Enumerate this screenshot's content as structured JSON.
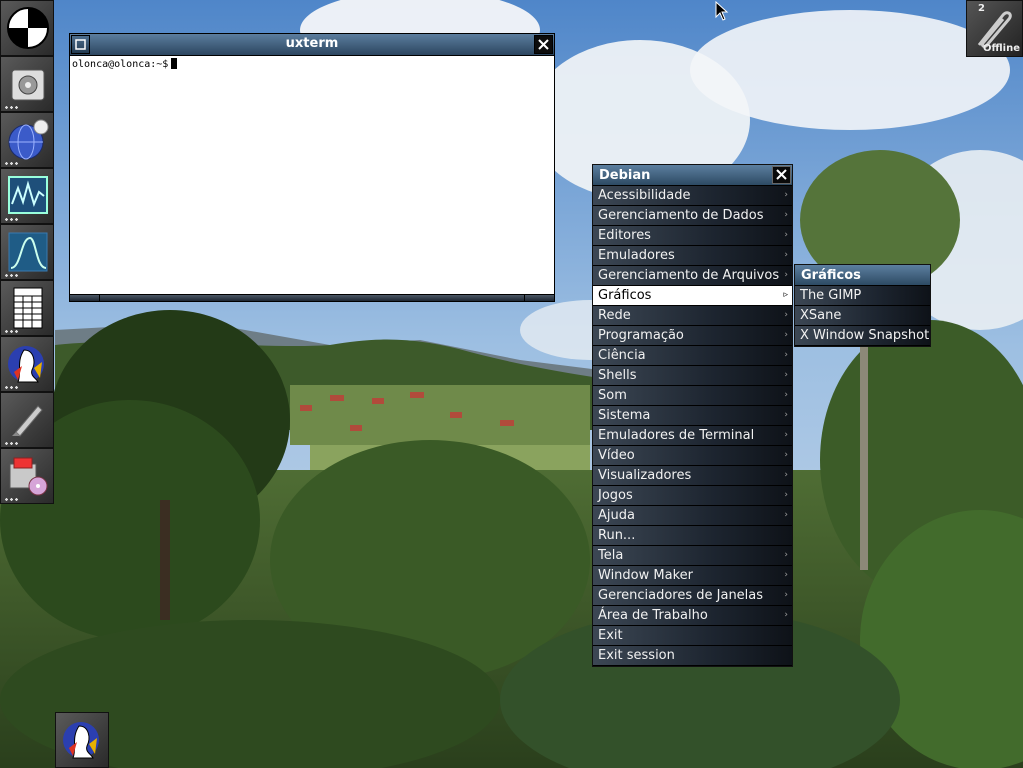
{
  "colors": {
    "titlebar_top": "#5b7d9e",
    "titlebar_bottom": "#2c4660",
    "menu_item_dark": "#1d2530",
    "menu_selected": "#ffffff"
  },
  "dock": {
    "items": [
      {
        "name": "windowmaker-dock-icon"
      },
      {
        "name": "disk-icon"
      },
      {
        "name": "browser-globe-icon"
      },
      {
        "name": "system-monitor-icon"
      },
      {
        "name": "wave-graph-icon"
      },
      {
        "name": "spreadsheet-icon"
      },
      {
        "name": "debian-penguin-icon"
      },
      {
        "name": "rocket-icon"
      },
      {
        "name": "installer-icon"
      }
    ]
  },
  "clip": {
    "workspace_number": "2",
    "workspace_name": "Offline",
    "icon": "paperclip-icon"
  },
  "xterm": {
    "title": "uxterm",
    "prompt": "olonca@olonca:~$"
  },
  "root_menu": {
    "title": "Debian",
    "items": [
      {
        "label": "Acessibilidade",
        "submenu": true
      },
      {
        "label": "Gerenciamento de Dados",
        "submenu": true
      },
      {
        "label": "Editores",
        "submenu": true
      },
      {
        "label": "Emuladores",
        "submenu": true
      },
      {
        "label": "Gerenciamento de Arquivos",
        "submenu": true
      },
      {
        "label": "Gráficos",
        "submenu": true,
        "selected": true
      },
      {
        "label": "Rede",
        "submenu": true
      },
      {
        "label": "Programação",
        "submenu": true
      },
      {
        "label": "Ciência",
        "submenu": true
      },
      {
        "label": "Shells",
        "submenu": true
      },
      {
        "label": "Som",
        "submenu": true
      },
      {
        "label": "Sistema",
        "submenu": true
      },
      {
        "label": "Emuladores de Terminal",
        "submenu": true
      },
      {
        "label": "Vídeo",
        "submenu": true
      },
      {
        "label": "Visualizadores",
        "submenu": true
      },
      {
        "label": "Jogos",
        "submenu": true
      },
      {
        "label": "Ajuda",
        "submenu": true
      },
      {
        "label": "Run...",
        "submenu": false
      },
      {
        "label": "Tela",
        "submenu": true
      },
      {
        "label": "Window Maker",
        "submenu": true
      },
      {
        "label": "Gerenciadores de Janelas",
        "submenu": true
      },
      {
        "label": "Área de Trabalho",
        "submenu": true
      },
      {
        "label": "Exit",
        "submenu": false
      },
      {
        "label": "Exit session",
        "submenu": false
      }
    ]
  },
  "graphics_menu": {
    "title": "Gráficos",
    "items": [
      {
        "label": "The GIMP"
      },
      {
        "label": "XSane"
      },
      {
        "label": "X Window Snapshot"
      }
    ]
  },
  "bottom_icon": {
    "name": "debian-penguin-icon"
  }
}
